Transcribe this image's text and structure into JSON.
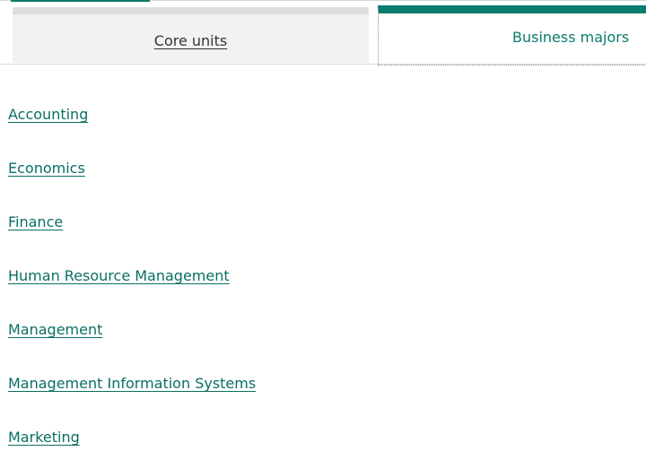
{
  "tabs": {
    "core_units": {
      "label": "Core units"
    },
    "business_majors": {
      "label": "Business majors"
    }
  },
  "majors": [
    {
      "label": "Accounting"
    },
    {
      "label": "Economics"
    },
    {
      "label": "Finance"
    },
    {
      "label": "Human Resource Management"
    },
    {
      "label": "Management"
    },
    {
      "label": "Management Information Systems"
    },
    {
      "label": "Marketing"
    }
  ],
  "colors": {
    "accent": "#0a7d6d",
    "link": "#0a6f62",
    "inactive_tab_bg": "#f2f2f2"
  }
}
